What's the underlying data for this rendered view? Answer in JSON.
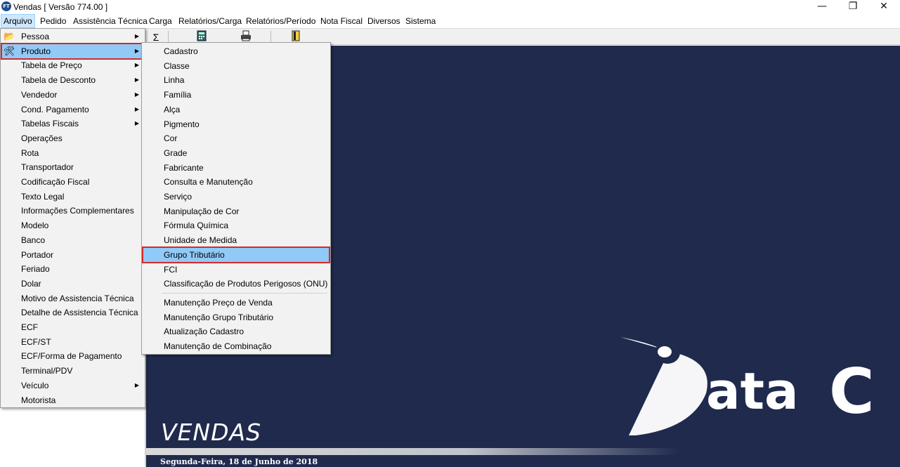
{
  "window": {
    "title": "Vendas [ Versão 774.00 ]",
    "app_icon_text": "FT"
  },
  "window_controls": {
    "minimize": "—",
    "maximize": "❐",
    "close": "✕"
  },
  "menubar": [
    "Arquivo",
    "Pedido",
    "Assistência Técnica",
    "Carga",
    "Relatórios/Carga",
    "Relatórios/Período",
    "Nota Fiscal",
    "Diversos",
    "Sistema"
  ],
  "toolbar": {
    "sum_icon": "Σ"
  },
  "arquivo_menu": [
    {
      "label": "Pessoa",
      "submenu": true
    },
    {
      "label": "Produto",
      "submenu": true,
      "highlighted": true
    },
    {
      "label": "Tabela de Preço",
      "submenu": true
    },
    {
      "label": "Tabela de Desconto",
      "submenu": true
    },
    {
      "label": "Vendedor",
      "submenu": true
    },
    {
      "label": "Cond. Pagamento",
      "submenu": true
    },
    {
      "label": "Tabelas Fiscais",
      "submenu": true
    },
    {
      "label": "Operações"
    },
    {
      "label": "Rota"
    },
    {
      "label": "Transportador"
    },
    {
      "label": "Codificação Fiscal"
    },
    {
      "label": "Texto Legal"
    },
    {
      "label": "Informações Complementares"
    },
    {
      "label": "Modelo"
    },
    {
      "label": "Banco"
    },
    {
      "label": "Portador"
    },
    {
      "label": "Feriado"
    },
    {
      "label": "Dolar"
    },
    {
      "label": "Motivo de Assistencia Técnica"
    },
    {
      "label": "Detalhe de Assistencia Técnica"
    },
    {
      "label": "ECF"
    },
    {
      "label": "ECF/ST"
    },
    {
      "label": "ECF/Forma de Pagamento"
    },
    {
      "label": "Terminal/PDV"
    },
    {
      "label": "Veículo",
      "submenu": true
    },
    {
      "label": "Motorista"
    }
  ],
  "produto_menu": [
    {
      "label": "Cadastro"
    },
    {
      "label": "Classe"
    },
    {
      "label": "Linha"
    },
    {
      "label": "Família"
    },
    {
      "label": "Alça"
    },
    {
      "label": "Pigmento"
    },
    {
      "label": "Cor"
    },
    {
      "label": "Grade"
    },
    {
      "label": "Fabricante"
    },
    {
      "label": "Consulta e Manutenção"
    },
    {
      "label": "Serviço"
    },
    {
      "label": "Manipulação de Cor"
    },
    {
      "label": "Fórmula Química"
    },
    {
      "label": "Unidade de Medida"
    },
    {
      "label": "Grupo Tributário",
      "highlighted": true
    },
    {
      "label": "FCI"
    },
    {
      "label": "Classificação de Produtos Perigosos (ONU)"
    },
    {
      "label": "Manutenção Preço de Venda",
      "separator_before": true
    },
    {
      "label": "Manutenção Grupo Tributário"
    },
    {
      "label": "Atualização Cadastro"
    },
    {
      "label": "Manutenção de Combinação"
    }
  ],
  "background": {
    "logo_text": "Data C",
    "logo_letters": [
      "ata",
      "C"
    ],
    "app_name": "VENDAS",
    "date": "Segunda-Feira, 18 de Junho de 2018"
  },
  "colors": {
    "navy": "#1f2a4d",
    "highlight": "#91c9f7",
    "marker": "#d42a2a"
  }
}
